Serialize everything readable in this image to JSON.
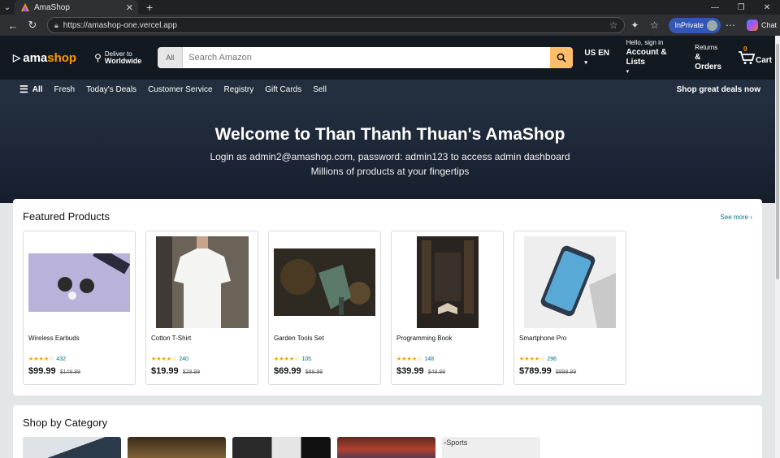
{
  "browser": {
    "tab_title": "AmaShop",
    "url": "https://amashop-one.vercel.app",
    "inprivate_label": "InPrivate",
    "copilot_label": "Chat"
  },
  "header": {
    "logo_text_a": "ama",
    "logo_text_b": "shop",
    "deliver_line1": "Deliver to",
    "deliver_line2": "Worldwide",
    "search_category": "All",
    "search_placeholder": "Search Amazon",
    "lang": "US EN",
    "account_line1": "Hello, sign in",
    "account_line2": "Account & Lists",
    "orders_line1": "Returns",
    "orders_line2": "& Orders",
    "cart_label": "Cart",
    "cart_count": "0"
  },
  "subnav": {
    "all": "All",
    "items": [
      "Fresh",
      "Today's Deals",
      "Customer Service",
      "Registry",
      "Gift Cards",
      "Sell"
    ],
    "promo": "Shop great deals now"
  },
  "hero": {
    "title": "Welcome to Than Thanh Thuan's AmaShop",
    "line1": "Login as admin2@amashop.com, password: admin123 to access admin dashboard",
    "line2": "Millions of products at your fingertips"
  },
  "featured": {
    "title": "Featured Products",
    "see_more": "See more ›",
    "products": [
      {
        "name": "Wireless Earbuds",
        "stars": "★★★★☆",
        "reviews": "432",
        "price": "$99.99",
        "old_price": "$149.99"
      },
      {
        "name": "Cotton T-Shirt",
        "stars": "★★★★☆",
        "reviews": "240",
        "price": "$19.99",
        "old_price": "$29.99"
      },
      {
        "name": "Garden Tools Set",
        "stars": "★★★★☆",
        "reviews": "105",
        "price": "$69.99",
        "old_price": "$89.99"
      },
      {
        "name": "Programming Book",
        "stars": "★★★★☆",
        "reviews": "148",
        "price": "$39.99",
        "old_price": "$49.99"
      },
      {
        "name": "Smartphone Pro",
        "stars": "★★★★☆",
        "reviews": "296",
        "price": "$789.99",
        "old_price": "$999.99"
      }
    ]
  },
  "categories": {
    "title": "Shop by Category",
    "broken_alt": "Sports"
  },
  "colors": {
    "accent": "#ff9900",
    "header_bg": "#131921",
    "subnav_bg": "#232f3e",
    "search_btn": "#febd69"
  }
}
